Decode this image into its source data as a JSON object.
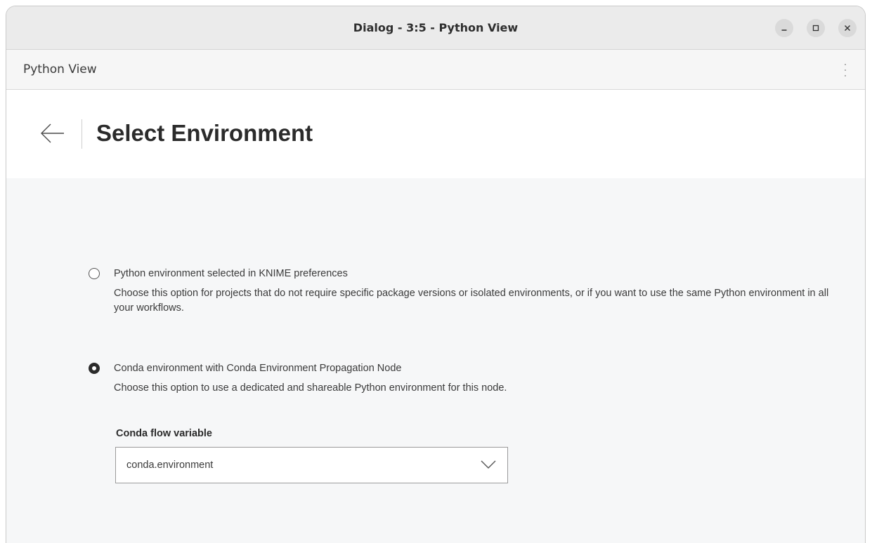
{
  "window": {
    "title": "Dialog - 3:5 - Python View"
  },
  "menubar": {
    "node_name": "Python View"
  },
  "header": {
    "title": "Select Environment"
  },
  "options": [
    {
      "label": "Python environment selected in KNIME preferences",
      "description": "Choose this option for projects that do not require specific package versions or isolated environments, or if you want to use the same Python environment in all your workflows.",
      "selected": false
    },
    {
      "label": "Conda environment with Conda Environment Propagation Node",
      "description": "Choose this option to use a dedicated and shareable Python environment for this node.",
      "selected": true
    }
  ],
  "conda": {
    "field_label": "Conda flow variable",
    "selected_value": "conda.environment"
  },
  "icons": {
    "minimize": "minimize-icon",
    "maximize": "maximize-icon",
    "close": "close-icon",
    "menu": "kebab-menu-icon",
    "back": "arrow-left-icon",
    "dropdown": "chevron-down-icon"
  }
}
